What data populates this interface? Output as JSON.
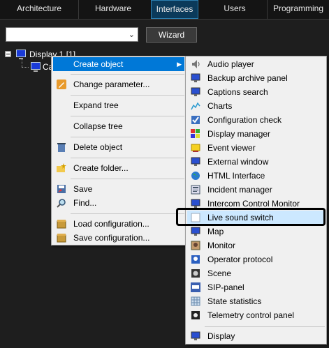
{
  "tabs": [
    "Architecture",
    "Hardware",
    "Interfaces",
    "Users",
    "Programming"
  ],
  "active_tab": "Interfaces",
  "toolbar": {
    "combo_value": "",
    "wizard_label": "Wizard"
  },
  "tree": {
    "root_label": "Display 1 [1]",
    "child_label": "Ca"
  },
  "context_menu": {
    "items": [
      {
        "label": "Create object",
        "icon": "none",
        "highlighted": true,
        "has_submenu": true
      },
      {
        "label": "Change parameter...",
        "icon": "pencil-icon"
      },
      {
        "label": "Expand tree",
        "icon": "none"
      },
      {
        "label": "Collapse tree",
        "icon": "none"
      },
      {
        "label": "Delete object",
        "icon": "delete-icon"
      },
      {
        "label": "Create folder...",
        "icon": "folder-new-icon"
      },
      {
        "label": "Save",
        "icon": "save-icon"
      },
      {
        "label": "Find...",
        "icon": "magnifier-icon"
      },
      {
        "label": "Load configuration...",
        "icon": "box-icon"
      },
      {
        "label": "Save configuration...",
        "icon": "box-icon"
      }
    ]
  },
  "submenu": {
    "items": [
      {
        "label": "Audio player",
        "icon": "audio-player-icon"
      },
      {
        "label": "Backup archive panel",
        "icon": "monitor-icon"
      },
      {
        "label": "Captions search",
        "icon": "monitor-icon"
      },
      {
        "label": "Charts",
        "icon": "charts-icon"
      },
      {
        "label": "Configuration check",
        "icon": "config-check-icon"
      },
      {
        "label": "Display manager",
        "icon": "display-manager-icon"
      },
      {
        "label": "Event viewer",
        "icon": "event-viewer-icon"
      },
      {
        "label": "External window",
        "icon": "monitor-icon"
      },
      {
        "label": "HTML Interface",
        "icon": "globe-icon"
      },
      {
        "label": "Incident manager",
        "icon": "incident-icon"
      },
      {
        "label": "Intercom Control Monitor",
        "icon": "monitor-icon"
      },
      {
        "label": "Live sound switch",
        "icon": "blank-window-icon",
        "highlighted": true
      },
      {
        "label": "Map",
        "icon": "map-icon"
      },
      {
        "label": "Monitor",
        "icon": "camera-monitor-icon"
      },
      {
        "label": "Operator protocol",
        "icon": "operator-icon"
      },
      {
        "label": "Scene",
        "icon": "scene-icon"
      },
      {
        "label": "SIP-panel",
        "icon": "sip-icon"
      },
      {
        "label": "State statistics",
        "icon": "grid-icon"
      },
      {
        "label": "Telemetry control panel",
        "icon": "telemetry-icon"
      },
      {
        "label": "Display",
        "icon": "display-icon"
      }
    ]
  },
  "colors": {
    "accent": "#0078d7",
    "tab_active": "#0b3a5a",
    "background": "#1e1e1e",
    "menu_bg": "#f0f0f0"
  }
}
